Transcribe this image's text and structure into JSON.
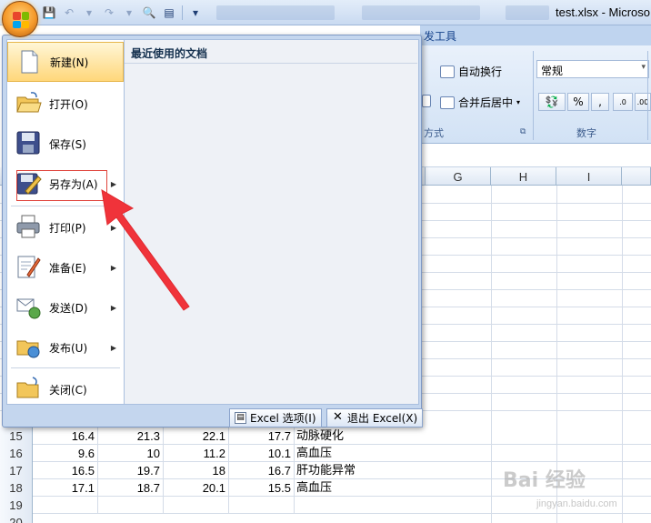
{
  "window": {
    "title": "test.xlsx - Microso"
  },
  "ribbon": {
    "tab_developer": "发工具",
    "wrap_text": "自动换行",
    "merge_center": "合并后居中",
    "alignment_group_partial": "方式",
    "number_format": "常规",
    "percent": "%",
    "comma": ",",
    "number_group": "数字"
  },
  "office_menu": {
    "recent_documents_title": "最近使用的文档",
    "items": [
      {
        "label": "新建(N)",
        "icon": "new-document-icon"
      },
      {
        "label": "打开(O)",
        "icon": "open-folder-icon"
      },
      {
        "label": "保存(S)",
        "icon": "save-disk-icon"
      },
      {
        "label": "另存为(A)",
        "icon": "save-as-icon"
      },
      {
        "label": "打印(P)",
        "icon": "printer-icon"
      },
      {
        "label": "准备(E)",
        "icon": "prepare-icon"
      },
      {
        "label": "发送(D)",
        "icon": "send-icon"
      },
      {
        "label": "发布(U)",
        "icon": "publish-icon"
      },
      {
        "label": "关闭(C)",
        "icon": "close-folder-icon"
      }
    ],
    "footer": {
      "options": "Excel 选项(I)",
      "exit": "退出 Excel(X)"
    }
  },
  "sheet": {
    "columns": [
      "G",
      "H",
      "I"
    ],
    "rows": [
      {
        "num": "15",
        "b": "16.4",
        "c": "21.3",
        "d": "22.1",
        "e": "17.7",
        "f": "动脉硬化"
      },
      {
        "num": "16",
        "b": "9.6",
        "c": "10",
        "d": "11.2",
        "e": "10.1",
        "f": "高血压"
      },
      {
        "num": "17",
        "b": "16.5",
        "c": "19.7",
        "d": "18",
        "e": "16.7",
        "f": "肝功能异常"
      },
      {
        "num": "18",
        "b": "17.1",
        "c": "18.7",
        "d": "20.1",
        "e": "15.5",
        "f": "高血压"
      },
      {
        "num": "19",
        "b": "",
        "c": "",
        "d": "",
        "e": "",
        "f": ""
      },
      {
        "num": "20",
        "b": "",
        "c": "",
        "d": "",
        "e": "",
        "f": ""
      }
    ]
  },
  "watermark": {
    "brand": "Bai 经验",
    "url": "jingyan.baidu.com"
  }
}
